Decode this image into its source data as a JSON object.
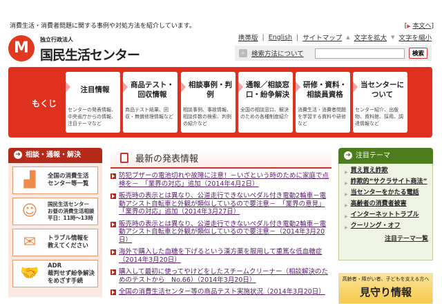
{
  "header": {
    "tagline": "消費生活・消費者問題に関する事例や対処方法を紹介しています。",
    "skip_link": "本文へ",
    "logo_sub": "独立行政法人",
    "logo_main": "国民生活センター"
  },
  "toplinks": [
    {
      "label": "携帯版"
    },
    {
      "label": "English"
    },
    {
      "label": "サイトマップ"
    },
    {
      "label": "文字を拡大"
    },
    {
      "label": "文字を縮小"
    }
  ],
  "search": {
    "help_link": "検索方法について",
    "value": "",
    "button": "検索"
  },
  "nav": {
    "label": "もくじ",
    "cards": [
      {
        "title": "注目情報",
        "desc": "センターの発表情報、中央省庁からの情報、注目テーマなど"
      },
      {
        "title": "商品テスト・回収情報",
        "desc": "商品テスト結果、回収・無償修理情報など"
      },
      {
        "title": "相談事例・判例",
        "desc": "相談事例、事故情報、相談件数の検索、判例の紹介など"
      },
      {
        "title": "通報／相談窓口・紛争解決",
        "desc": "全国の相談窓口、解決のための各種制度紹介"
      },
      {
        "title": "研修・資料・相談員資格",
        "desc": "消費生活・消費者問題を学習する資料や研修など"
      },
      {
        "title": "当センターについて",
        "desc": "センター紹介、出版物、資料館、採用、調達情報など"
      }
    ]
  },
  "left": {
    "title": "相談・通報・解決",
    "items": [
      {
        "lines": [
          "全国の消費生活",
          "センター等一覧"
        ]
      },
      {
        "lines": [
          "国民生活センター",
          "お昼の消費生活相談",
          "平日：11時～13時"
        ]
      },
      {
        "lines": [
          "トラブル情報を",
          "教えてください"
        ]
      },
      {
        "lines": [
          "ADR",
          "裁判せず紛争解決",
          "をめざす手続"
        ]
      }
    ]
  },
  "news": {
    "title": "最新の発表情報",
    "items": [
      "防犯ブザーの電池切れや故障に注意！－いざという時のために家庭で点検を－　「業界の対応」追加（2014年4月2日）",
      "販売時の表示とは異なり、公道走行できないペダル付き電動2輪車－電動アシスト自転車と外観が類似しているので要注意－　「業界の意見」「業界の対応」追加（2014年3月27日）",
      "販売時の表示とは異なり、公道走行できないペダル付き電動2輪車－電動アシスト自転車と外観が類似しているので要注意－（2014年3月20日）",
      "海外で購入した血糖を下げるという漢方薬を服用して重篤な低血糖症（2014年3月20日）",
      "購入して最初に使ってやけどをしたスチームクリーナー（相談解決のためのテストから　No.66）（2014年3月20日）",
      "全国の消費生活センター等の商品テスト実施状況（2014年3月20日）"
    ]
  },
  "right": {
    "title": "注目テーマ",
    "items": [
      "買え買え詐欺",
      "詐欺的“サクラサイト商法”",
      "当センターをかたる電話",
      "高齢者の消費者被害",
      "インターネットトラブル",
      "クーリング・オフ"
    ],
    "all_link": "注目テーマ一覧",
    "banner": {
      "sub": "高齢者・障がい者、子どもを支える方へ",
      "title": "見守り情報"
    }
  }
}
